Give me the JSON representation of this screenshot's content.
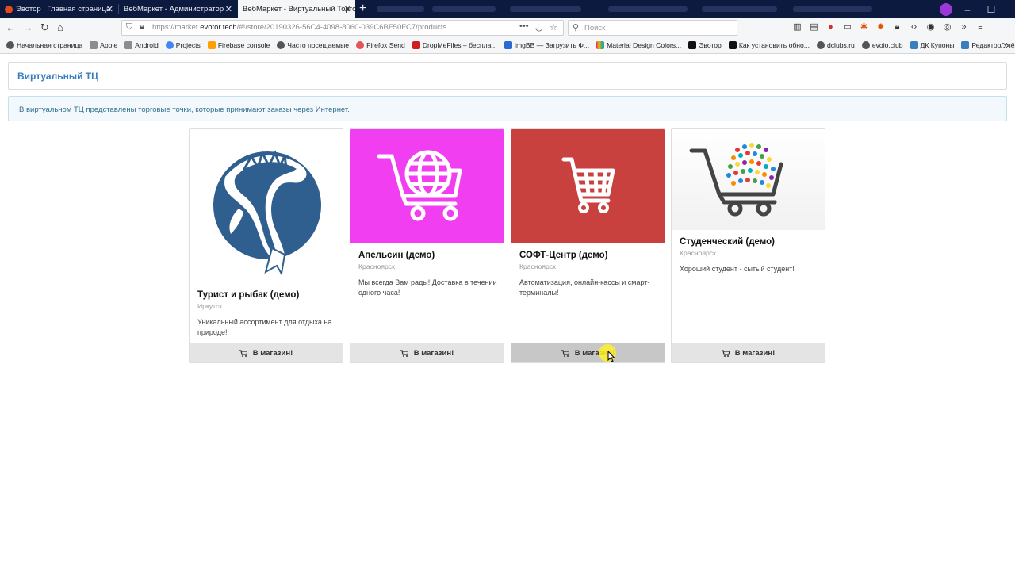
{
  "browser": {
    "tabs": [
      {
        "title": "Эвотор | Главная страница",
        "favicon_color": "#e64a19"
      },
      {
        "title": "ВебМаркет - Администратор",
        "favicon_color": "#0b1a3e"
      },
      {
        "title": "ВебМаркет - Виртуальный Торгов...",
        "favicon_color": "#f5f6f7"
      }
    ],
    "url_host": "https://market.",
    "url_domain": "evotor.tech",
    "url_path": "/#!/store/20190326-56C4-4098-8060-039C6BF50FC7/products",
    "search_placeholder": "Поиск",
    "bookmarks": [
      {
        "label": "Начальная страница",
        "icon": "globe-icon",
        "color": "#555555"
      },
      {
        "label": "Apple",
        "icon": "folder-icon",
        "color": "#777777"
      },
      {
        "label": "Android",
        "icon": "folder-icon",
        "color": "#777777"
      },
      {
        "label": "Projects",
        "icon": "google-icon",
        "color": "#4285f4"
      },
      {
        "label": "Firebase console",
        "icon": "firebase-icon",
        "color": "#ffa000"
      },
      {
        "label": "Часто посещаемые",
        "icon": "gear-icon",
        "color": "#555555"
      },
      {
        "label": "Firefox Send",
        "icon": "send-icon",
        "color": "#e6525b"
      },
      {
        "label": "DropMeFiles – бесплa...",
        "icon": "dropmefiles-icon",
        "color": "#cc2020"
      },
      {
        "label": "ImgBB — Загрузить Ф...",
        "icon": "imgbb-icon",
        "color": "#2a6ad1"
      },
      {
        "label": "Material Design Colors...",
        "icon": "palette-icon",
        "color": "#e91e63"
      },
      {
        "label": "Эвотор",
        "icon": "plus-icon",
        "color": "#111111"
      },
      {
        "label": "Как установить обно...",
        "icon": "plus-icon",
        "color": "#111111"
      },
      {
        "label": "dclubs.ru",
        "icon": "globe-icon",
        "color": "#555555"
      },
      {
        "label": "evoio.club",
        "icon": "globe-icon",
        "color": "#555555"
      },
      {
        "label": "ДК Купоны",
        "icon": "coupon-icon",
        "color": "#3a7ec0"
      },
      {
        "label": "Редактор/Учёт",
        "icon": "editor-icon",
        "color": "#3a7ec0"
      }
    ]
  },
  "page": {
    "title": "Виртуальный ТЦ",
    "info": "В виртуальном ТЦ представлены торговые точки, которые принимают заказы через Интернет."
  },
  "stores": [
    {
      "name": "Турист и рыбак (демо)",
      "city": "Иркутск",
      "description": "Уникальный ассортимент для отдыха на природе!",
      "button": "В магазин!",
      "image": "fish-logo",
      "image_bg": "#ffffff"
    },
    {
      "name": "Апельсин (демо)",
      "city": "Красноярск",
      "description": "Мы всегда Вам рады! Доставка в течении одного часа!",
      "button": "В магазин!",
      "image": "globe-cart",
      "image_bg": "#f03ef0"
    },
    {
      "name": "СОФТ-Центр (демо)",
      "city": "Красноярск",
      "description": "Автоматизация, онлайн-кассы и смарт-терминалы!",
      "button": "В магазин!",
      "image": "cart",
      "image_bg": "#c9413e"
    },
    {
      "name": "Студенческий (демо)",
      "city": "Красноярск",
      "description": "Хороший студент - сытый студент!",
      "button": "В магазин!",
      "image": "icons-cart",
      "image_bg": "#ffffff"
    }
  ],
  "colors": {
    "accent": "#3a7ec0",
    "info_bg": "#f2f8fb",
    "info_text": "#31708f"
  }
}
